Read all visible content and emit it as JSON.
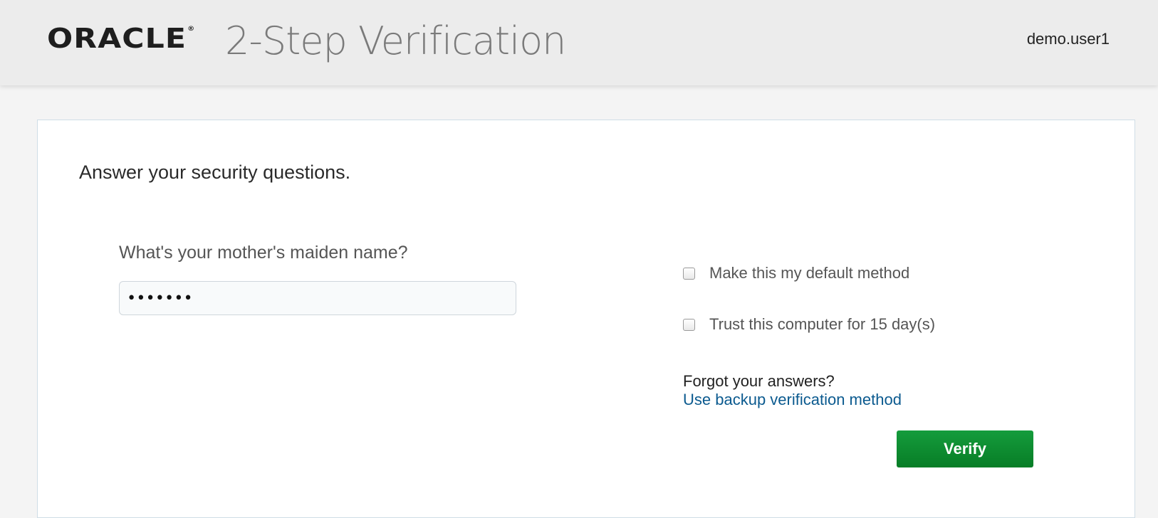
{
  "header": {
    "logo_text": "ORACLE",
    "logo_registered": "®",
    "title": "2-Step Verification",
    "username": "demo.user1"
  },
  "card": {
    "heading": "Answer your security questions.",
    "question": {
      "label": "What's your mother's maiden name?",
      "value": "•••••••"
    },
    "options": {
      "default_method_label": "Make this my default method",
      "default_method_checked": false,
      "trust_computer_label": "Trust this computer for 15 day(s)",
      "trust_computer_checked": false
    },
    "forgot_text": "Forgot your answers?",
    "backup_link": "Use backup verification method",
    "verify_label": "Verify"
  },
  "colors": {
    "header_bg": "#ececec",
    "page_bg": "#f4f4f4",
    "link": "#0b5a8f",
    "verify_button": "#0f8a31"
  }
}
